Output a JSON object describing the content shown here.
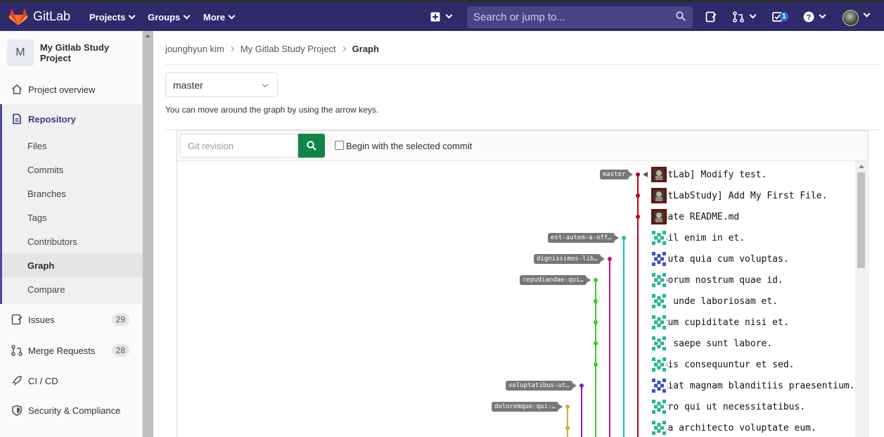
{
  "navbar": {
    "brand": "GitLab",
    "menu": [
      "Projects",
      "Groups",
      "More"
    ],
    "search_placeholder": "Search or jump to...",
    "todo_count": "1"
  },
  "sidebar": {
    "project_initial": "M",
    "project_name": "My Gitlab Study Project",
    "overview": "Project overview",
    "repository": "Repository",
    "repo_items": [
      "Files",
      "Commits",
      "Branches",
      "Tags",
      "Contributors",
      "Graph",
      "Compare"
    ],
    "active_item": "Graph",
    "issues": {
      "label": "Issues",
      "count": "29"
    },
    "merge_requests": {
      "label": "Merge Requests",
      "count": "28"
    },
    "cicd": "CI / CD",
    "security": "Security & Compliance"
  },
  "breadcrumb": [
    "jounghyun kim",
    "My Gitlab Study Project",
    "Graph"
  ],
  "branch": "master",
  "hint": "You can move around the graph by using the arrow keys.",
  "revision": {
    "placeholder": "Git revision",
    "checkbox_label": "Begin with the selected commit"
  },
  "commits": [
    {
      "message": "[GitLab] Modify test.",
      "ref": "master",
      "color": "#c0001f"
    },
    {
      "message": "[GitLabStudy] Add My First File.",
      "ref": "",
      "color": "#c0001f"
    },
    {
      "message": "Update README.md",
      "ref": "",
      "color": "#c0001f"
    },
    {
      "message": "Nihil enim in et.",
      "ref": "est-autem-a-off…",
      "color": "#14c1b6"
    },
    {
      "message": "Soluta quia cum voluptas.",
      "ref": "dignissimos-lib…",
      "color": "#c4127f"
    },
    {
      "message": "Laborum nostrum quae id.",
      "ref": "repudiandae-qui…",
      "color": "#3fca25"
    },
    {
      "message": "Aut unde laboriosam et.",
      "ref": "",
      "color": "#3fca25"
    },
    {
      "message": "Harum cupiditate nisi et.",
      "ref": "",
      "color": "#3fca25"
    },
    {
      "message": "Aut saepe sunt labore.",
      "ref": "",
      "color": "#3fca25"
    },
    {
      "message": "Nobis consequuntur et sed.",
      "ref": "",
      "color": "#3fca25"
    },
    {
      "message": "Fugiat magnam blanditiis praesentium.",
      "ref": "voluptatibus-ut…",
      "color": "#7e1fc4"
    },
    {
      "message": "Porro qui ut necessitatibus.",
      "ref": "doloremque-qui-…",
      "color": "#c9b43a"
    },
    {
      "message": "Quia architecto voluptate eum.",
      "ref": "",
      "color": "#c9b43a"
    }
  ]
}
